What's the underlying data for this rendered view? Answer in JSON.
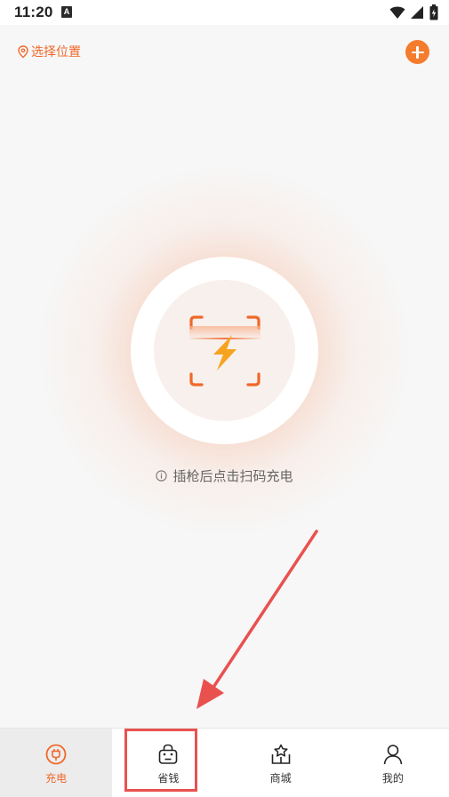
{
  "status_bar": {
    "time": "11:20",
    "notification_icon": "a-badge-icon",
    "icons": [
      "wifi-icon",
      "cellular-icon",
      "battery-icon"
    ]
  },
  "header": {
    "location_label": "选择位置",
    "location_icon": "location-pin-icon",
    "add_icon": "plus-circle-icon"
  },
  "main": {
    "scan_icon": "scan-charge-icon",
    "hint_icon": "info-icon",
    "hint_text": "插枪后点击扫码充电"
  },
  "tabs": [
    {
      "label": "充电",
      "icon": "plug-icon",
      "active": true
    },
    {
      "label": "省钱",
      "icon": "bag-icon",
      "active": false
    },
    {
      "label": "商城",
      "icon": "shop-icon",
      "active": false
    },
    {
      "label": "我的",
      "icon": "user-icon",
      "active": false
    }
  ],
  "colors": {
    "accent": "#f0682a",
    "highlight_annotation": "#e9514f",
    "bolt": "#f6a31f"
  }
}
